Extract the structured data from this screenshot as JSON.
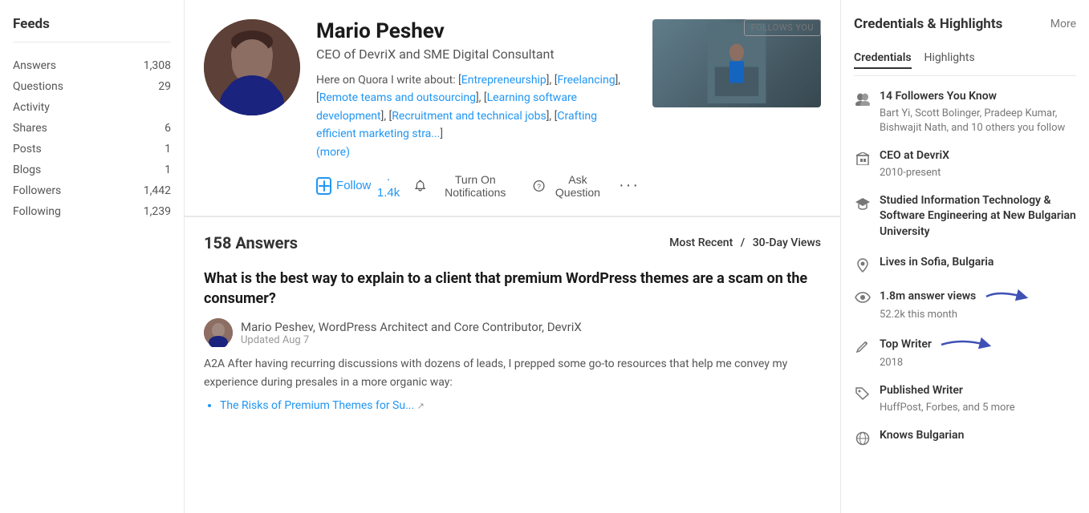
{
  "sidebar": {
    "title": "Feeds",
    "items": [
      {
        "label": "Answers",
        "count": "1,308"
      },
      {
        "label": "Questions",
        "count": "29"
      },
      {
        "label": "Activity",
        "count": ""
      },
      {
        "label": "Shares",
        "count": "6"
      },
      {
        "label": "Posts",
        "count": "1"
      },
      {
        "label": "Blogs",
        "count": "1"
      },
      {
        "label": "Followers",
        "count": "1,442"
      },
      {
        "label": "Following",
        "count": "1,239"
      }
    ]
  },
  "profile": {
    "name": "Mario Peshev",
    "title": "CEO of DevriX and SME Digital Consultant",
    "follows_you_badge": "FOLLOWS YOU",
    "bio_prefix": "Here on Quora I write about: [",
    "bio_topics": [
      "Entrepreneurship",
      "Freelancing",
      "Remote teams and outsourcing",
      "Learning software development",
      "Recruitment and technical jobs",
      "Crafting efficient marketing stra..."
    ],
    "bio_more": "(more)",
    "follow_label": "Follow",
    "follow_count": "· 1.4k",
    "notification_label": "Turn On Notifications",
    "ask_label": "Ask Question",
    "more_label": "···"
  },
  "content": {
    "answers_count": "158 Answers",
    "sort_primary": "Most Recent",
    "sort_divider": "/",
    "sort_secondary": "30-Day Views",
    "post": {
      "title": "What is the best way to explain to a client that premium WordPress themes are a scam on the consumer?",
      "author": "Mario Peshev, WordPress Architect and Core Contributor, DevriX",
      "date": "Updated Aug 7",
      "excerpt": "A2A After having recurring discussions with dozens of leads, I prepped some go-to resources that help me convey my experience during presales in a more organic way:",
      "link_text": "The Risks of Premium Themes for Su..."
    }
  },
  "credentials": {
    "title": "Credentials & Highlights",
    "more_label": "More",
    "tabs": [
      {
        "label": "Credentials",
        "active": true
      },
      {
        "label": "Highlights",
        "active": false
      }
    ],
    "items": [
      {
        "icon": "👥",
        "title": "14 Followers You Know",
        "subtitle": "Bart Yi, Scott Bolinger, Pradeep Kumar, Bishwajit Nath, and 10 others you follow"
      },
      {
        "icon": "🏢",
        "title": "CEO at DevriX",
        "subtitle": "2010-present"
      },
      {
        "icon": "🎓",
        "title": "Studied Information Technology & Software Engineering at New Bulgarian University",
        "subtitle": ""
      },
      {
        "icon": "📍",
        "title": "Lives in Sofia, Bulgaria",
        "subtitle": ""
      },
      {
        "icon": "👁",
        "title": "1.8m answer views",
        "subtitle": "52.2k this month",
        "has_arrow": true
      },
      {
        "icon": "✏️",
        "title": "Top Writer",
        "subtitle": "2018",
        "has_arrow": true
      },
      {
        "icon": "🏷️",
        "title": "Published Writer",
        "subtitle": "HuffPost, Forbes, and 5 more"
      },
      {
        "icon": "🌐",
        "title": "Knows Bulgarian",
        "subtitle": ""
      }
    ]
  }
}
